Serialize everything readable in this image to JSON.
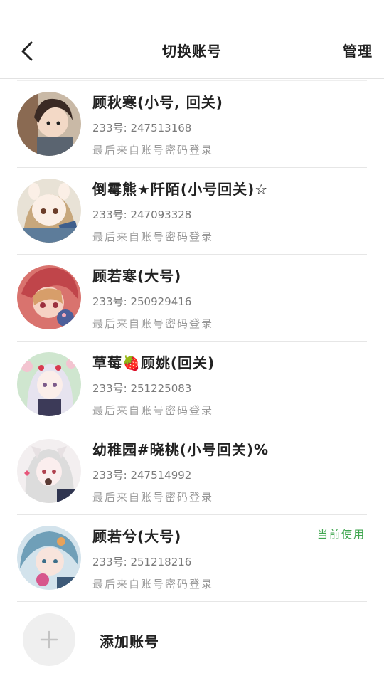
{
  "header": {
    "title": "切换账号",
    "manage_label": "管理"
  },
  "accounts": [
    {
      "name": "顾秋寒(小号, 回关)",
      "uid": "233号: 247513168",
      "login": "最后来自账号密码登录",
      "current": ""
    },
    {
      "name": "倒霉熊★阡陌(小号回关)☆",
      "uid": "233号: 247093328",
      "login": "最后来自账号密码登录",
      "current": ""
    },
    {
      "name": "顾若寒(大号)",
      "uid": "233号: 250929416",
      "login": "最后来自账号密码登录",
      "current": ""
    },
    {
      "name": "草莓🍓顾姚(回关)",
      "uid": "233号: 251225083",
      "login": "最后来自账号密码登录",
      "current": ""
    },
    {
      "name": "幼稚园#晓桃(小号回关)%",
      "uid": "233号: 247514992",
      "login": "最后来自账号密码登录",
      "current": ""
    },
    {
      "name": "顾若兮(大号)",
      "uid": "233号: 251218216",
      "login": "最后来自账号密码登录",
      "current": "当前使用"
    }
  ],
  "add_account": {
    "label": "添加账号"
  },
  "colors": {
    "accent_current": "#3fa64f",
    "divider": "#e6e6e6",
    "status_dot": "#f07a8a"
  }
}
